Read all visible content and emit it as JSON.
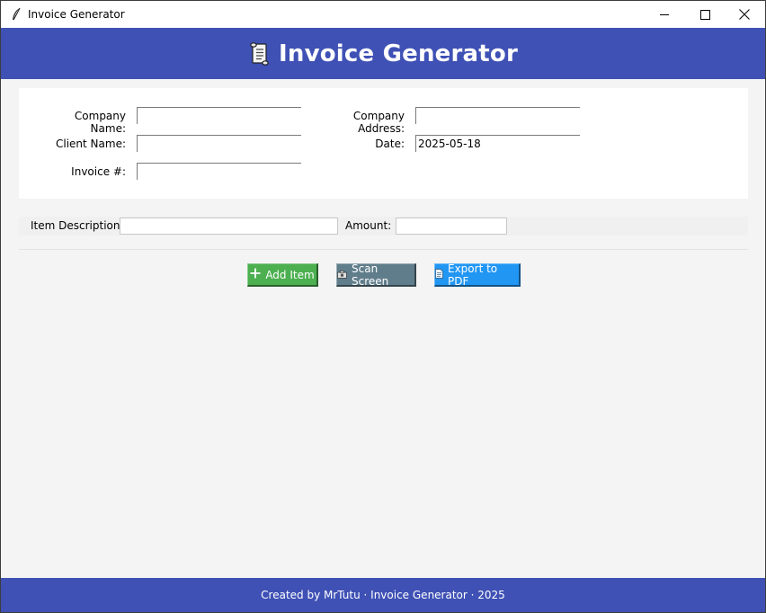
{
  "window": {
    "title": "Invoice Generator",
    "icon": "feather-icon"
  },
  "header": {
    "icon": "scroll-icon",
    "title": "Invoice Generator",
    "background": "#3f51b5"
  },
  "form": {
    "company_name_label": "Company Name:",
    "company_name_value": "",
    "company_address_label": "Company Address:",
    "company_address_value": "",
    "client_name_label": "Client Name:",
    "client_name_value": "",
    "date_label": "Date:",
    "date_value": "2025-05-18",
    "invoice_label": "Invoice #:",
    "invoice_value": ""
  },
  "item": {
    "description_label": "Item Description:",
    "description_value": "",
    "amount_label": "Amount:",
    "amount_value": ""
  },
  "buttons": {
    "add_item": {
      "label": "Add Item",
      "icon": "plus-icon",
      "color": "#4caf50"
    },
    "scan_screen": {
      "label": "Scan Screen",
      "icon": "camera-icon",
      "color": "#607d8b"
    },
    "export_pdf": {
      "label": "Export to PDF",
      "icon": "document-icon",
      "color": "#2196f3"
    }
  },
  "footer": {
    "text": "Created by MrTutu · Invoice Generator · 2025",
    "background": "#3f51b5"
  }
}
